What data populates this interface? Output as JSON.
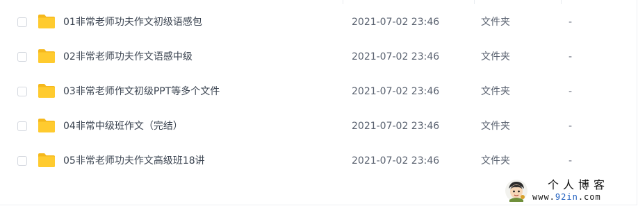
{
  "files": [
    {
      "name": "01非常老师功夫作文初级语感包",
      "date": "2021-07-02 23:46",
      "type": "文件夹",
      "size": "-"
    },
    {
      "name": "02非常老师功夫作文语感中级",
      "date": "2021-07-02 23:46",
      "type": "文件夹",
      "size": "-"
    },
    {
      "name": "03非常老师作文初级PPT等多个文件",
      "date": "2021-07-02 23:46",
      "type": "文件夹",
      "size": "-"
    },
    {
      "name": "04非常中级班作文（完结）",
      "date": "2021-07-02 23:46",
      "type": "文件夹",
      "size": "-"
    },
    {
      "name": "05非常老师功夫作文高级班18讲",
      "date": "2021-07-02 23:46",
      "type": "文件夹",
      "size": "-"
    }
  ],
  "watermark": {
    "line1": "个人博客",
    "line2_prefix": "www.",
    "line2_highlight": "92in",
    "line2_suffix": ".com"
  },
  "icons": {
    "folder": "folder-icon",
    "checkbox": "checkbox-icon",
    "avatar": "blog-avatar-icon"
  },
  "colors": {
    "folder": "#FFCB2F",
    "folder_tab": "#F5B81C",
    "name_text": "#3B4451",
    "meta_text": "#5A6270",
    "checkbox_border": "#D3D7DE",
    "watermark_highlight": "#1F5FBF"
  }
}
